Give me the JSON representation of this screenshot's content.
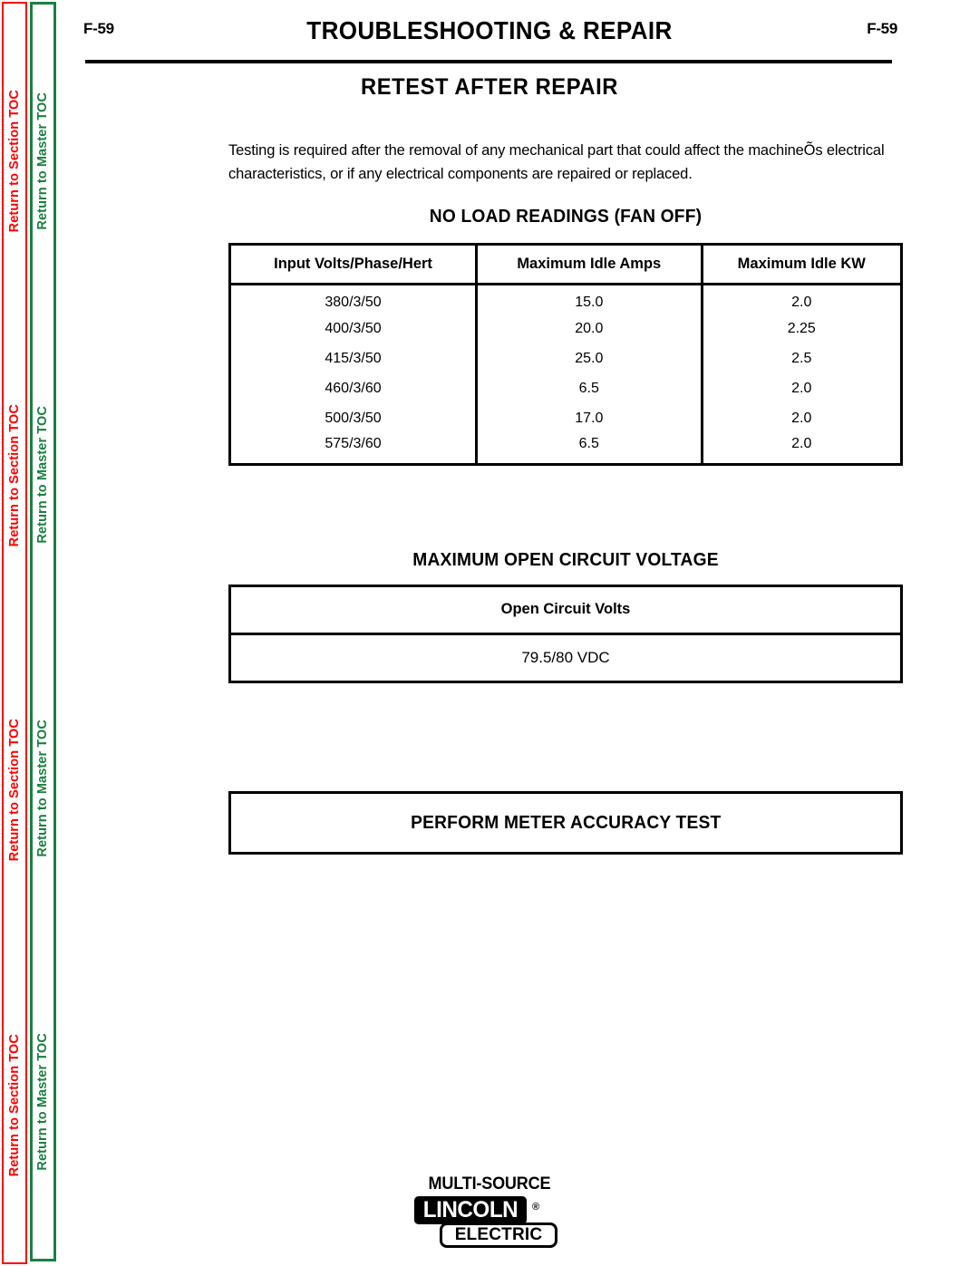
{
  "sidebar": {
    "section_toc": {
      "label": "Return to Section TOC",
      "color": "#ff0000",
      "repeat": 4
    },
    "master_toc": {
      "label": "Return to Master TOC",
      "color": "#1a8040",
      "repeat": 4
    }
  },
  "header": {
    "folio_left": "F-59",
    "folio_right": "F-59",
    "title": "TROUBLESHOOTING & REPAIR"
  },
  "section": {
    "title": "RETEST AFTER REPAIR",
    "intro": "Testing is required after the removal of any mechanical part that could affect the machineÕs electrical characteristics, or if any electrical components are repaired or replaced."
  },
  "no_load_readings": {
    "heading": "NO LOAD READINGS (FAN OFF)",
    "columns": [
      "Input Volts/Phase/Hert",
      "Maximum Idle Amps",
      "Maximum Idle KW"
    ],
    "rows": [
      [
        "380/3/50",
        "15.0",
        "2.0"
      ],
      [
        "400/3/50",
        "20.0",
        "2.25"
      ],
      [
        "415/3/50",
        "25.0",
        "2.5"
      ],
      [
        "460/3/60",
        "6.5",
        "2.0"
      ],
      [
        "500/3/50",
        "17.0",
        "2.0"
      ],
      [
        "575/3/60",
        "6.5",
        "2.0"
      ]
    ]
  },
  "open_circuit_voltage": {
    "heading": "MAXIMUM OPEN CIRCUIT VOLTAGE",
    "columns": [
      "Open Circuit Volts"
    ],
    "rows": [
      [
        "79.5/80 VDC"
      ]
    ]
  },
  "meter_accuracy": {
    "label": "PERFORM METER ACCURACY TEST"
  },
  "footer": {
    "tagline": "MULTI-SOURCE",
    "brand_primary": "LINCOLN",
    "brand_registered": "®",
    "brand_secondary": "ELECTRIC"
  }
}
